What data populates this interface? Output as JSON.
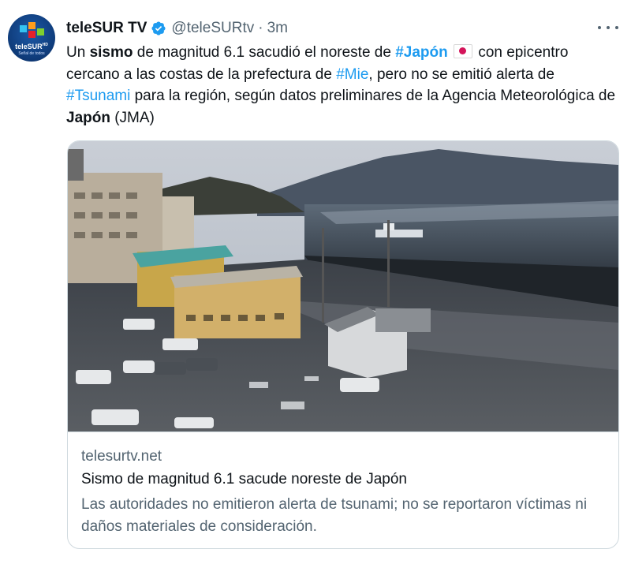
{
  "author": {
    "display_name": "teleSUR TV",
    "handle": "@teleSURtv",
    "separator": "·",
    "time": "3m",
    "verified_icon": "verified-badge-icon",
    "avatar": {
      "logo_text": "teleSUR",
      "logo_superscript": "HD",
      "logo_tagline": "Señal de todos"
    }
  },
  "more_menu_icon": "more-horizontal-icon",
  "tweet": {
    "segments": [
      {
        "text": "Un ",
        "style": "plain"
      },
      {
        "text": "sismo",
        "style": "bold"
      },
      {
        "text": " de magnitud 6.1 sacudió el noreste de ",
        "style": "plain"
      },
      {
        "text": "#Japón",
        "style": "hashtag-bold"
      },
      {
        "text": " ",
        "style": "plain"
      },
      {
        "text": " con epicentro cercano a las costas de la prefectura de ",
        "style": "plain"
      },
      {
        "text": "#Mie",
        "style": "hashtag"
      },
      {
        "text": ", pero no se emitió alerta de ",
        "style": "plain"
      },
      {
        "text": "#Tsunami",
        "style": "hashtag"
      },
      {
        "text": " para la región, según datos preliminares de la Agencia Meteorológica de ",
        "style": "plain"
      },
      {
        "text": "Japón",
        "style": "bold"
      },
      {
        "text": " (JMA)",
        "style": "plain"
      }
    ],
    "flag_emoji": "japan-flag-icon"
  },
  "card": {
    "image_subject": "tsunami-flooding-town-photo",
    "domain": "telesurtv.net",
    "title": "Sismo de magnitud 6.1 sacude noreste de Japón",
    "description": "Las autoridades no emitieron alerta de tsunami; no se reportaron víctimas ni daños materiales de consideración."
  },
  "colors": {
    "link": "#1d9bf0",
    "text_primary": "#0f1419",
    "text_secondary": "#536471",
    "border": "#cfd9de"
  }
}
